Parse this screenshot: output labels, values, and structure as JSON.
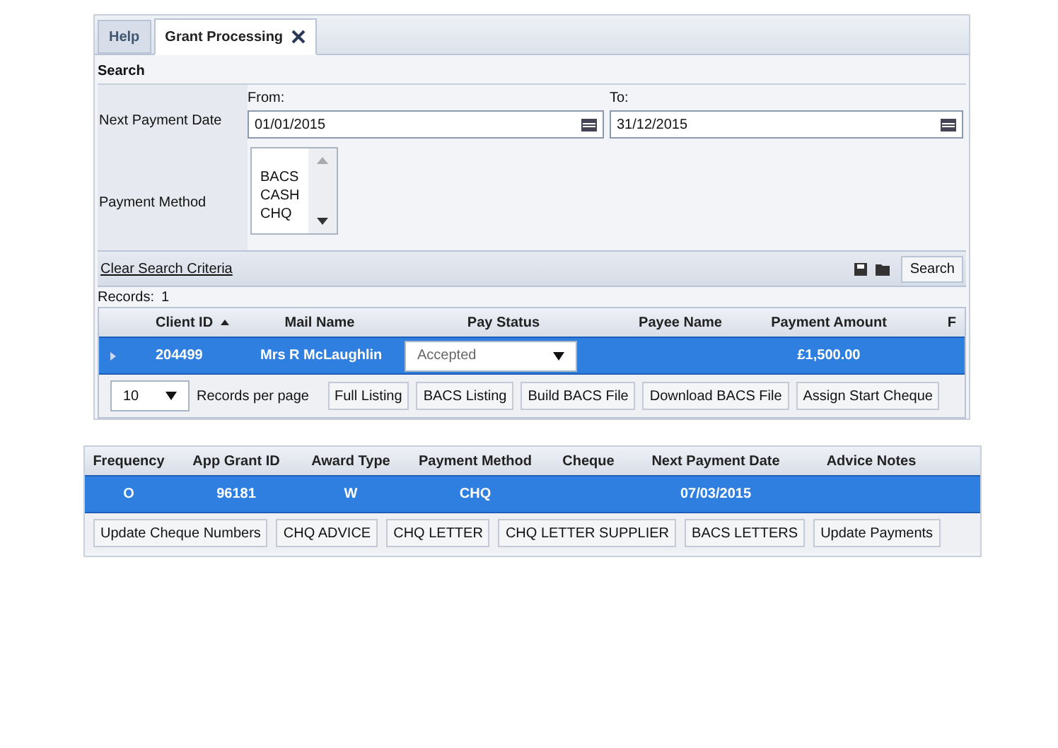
{
  "tabs": [
    {
      "label": "Help",
      "selected": false,
      "closable": false
    },
    {
      "label": "Grant Processing",
      "selected": true,
      "closable": true
    }
  ],
  "search": {
    "title": "Search",
    "date_label": "Next Payment Date",
    "from_label": "From:",
    "from_value": "01/01/2015",
    "to_label": "To:",
    "to_value": "31/12/2015",
    "method_label": "Payment Method",
    "methods": [
      "BACS",
      "CASH",
      "CHQ"
    ],
    "clear_link": "Clear Search Criteria",
    "search_button": "Search"
  },
  "records_label": "Records:",
  "records_count": "1",
  "table": {
    "columns": [
      {
        "label": "Client ID",
        "sorted": true
      },
      {
        "label": "Mail Name",
        "sorted": false
      },
      {
        "label": "Pay Status",
        "sorted": false
      },
      {
        "label": "Payee Name",
        "sorted": false
      },
      {
        "label": "Payment Amount",
        "sorted": false
      },
      {
        "label": "F",
        "sorted": false
      }
    ],
    "rows": [
      {
        "selected": true,
        "client_id": "204499",
        "mail_name": "Mrs R McLaughlin",
        "pay_status": "Accepted",
        "payee_name": "",
        "payment_amount": "£1,500.00"
      }
    ]
  },
  "pager": {
    "page_size": "10",
    "label": "Records per page"
  },
  "buttons": [
    "Full Listing",
    "BACS Listing",
    "Build BACS File",
    "Download BACS File",
    "Assign Start Cheque"
  ],
  "table2": {
    "columns": [
      "Frequency",
      "App Grant ID",
      "Award Type",
      "Payment Method",
      "Cheque",
      "Next Payment Date",
      "Advice Notes"
    ],
    "rows": [
      {
        "selected": true,
        "cells": [
          "O",
          "96181",
          "W",
          "CHQ",
          "",
          "07/03/2015",
          ""
        ]
      }
    ]
  },
  "buttons2": [
    "Update Cheque Numbers",
    "CHQ ADVICE",
    "CHQ LETTER",
    "CHQ LETTER SUPPLIER",
    "BACS LETTERS",
    "Update Payments"
  ]
}
